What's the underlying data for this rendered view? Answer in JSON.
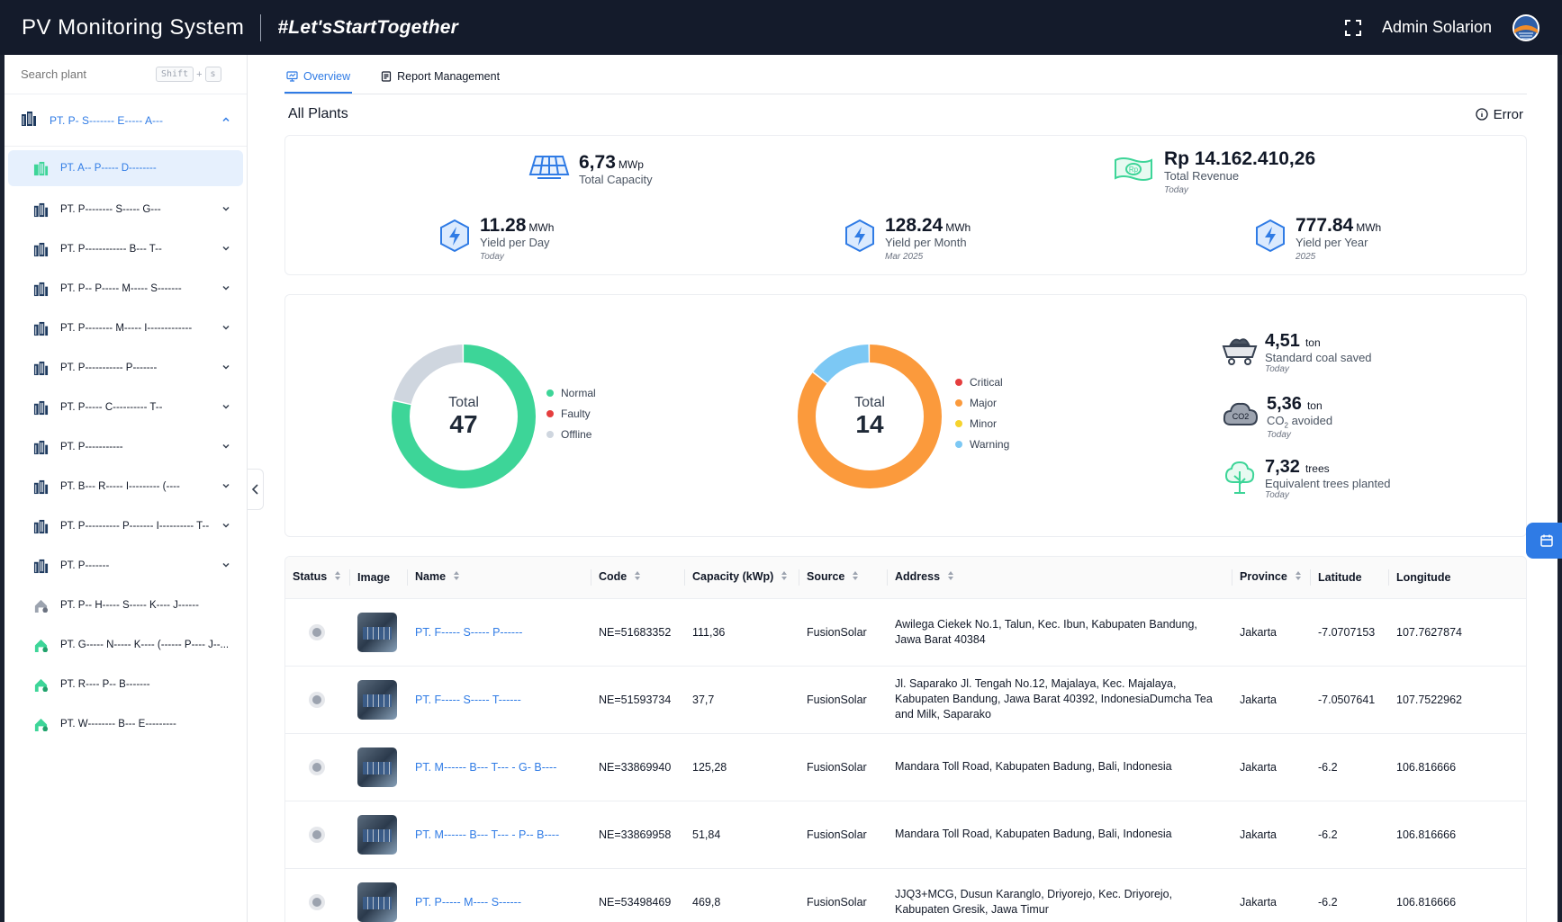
{
  "header": {
    "app_title": "PV Monitoring System",
    "tagline": "#Let'sStartTogether",
    "user_name": "Admin Solarion"
  },
  "sidebar": {
    "search_placeholder": "Search plant",
    "shortcut_key1": "Shift",
    "shortcut_plus": "+",
    "shortcut_key2": "s",
    "group_label": "PT. P- S------- E----- A---",
    "items": [
      {
        "label": "PT. A-- P----- D--------",
        "icon": "building-green-icon",
        "active": true
      },
      {
        "label": "PT. P-------- S----- G---",
        "icon": "building-icon"
      },
      {
        "label": "PT. P------------ B--- T--",
        "icon": "building-icon"
      },
      {
        "label": "PT. P-- P----- M----- S-------",
        "icon": "building-icon"
      },
      {
        "label": "PT. P-------- M----- I-------------",
        "icon": "building-icon"
      },
      {
        "label": "PT. P----------- P-------",
        "icon": "building-icon"
      },
      {
        "label": "PT. P----- C---------- T--",
        "icon": "building-icon"
      },
      {
        "label": "PT. P-----------",
        "icon": "building-icon"
      },
      {
        "label": "PT. B--- R----- I--------- (----",
        "icon": "building-icon"
      },
      {
        "label": "PT. P---------- P------- I---------- T--",
        "icon": "building-icon"
      },
      {
        "label": "PT. P-------",
        "icon": "building-icon"
      },
      {
        "label": "PT. P-- H----- S----- K---- J------",
        "icon": "house-gray-icon"
      },
      {
        "label": "PT. G----- N----- K---- (------ P---- J--...",
        "icon": "house-green-icon"
      },
      {
        "label": "PT. R---- P-- B-------",
        "icon": "house-green-icon"
      },
      {
        "label": "PT. W-------- B--- E---------",
        "icon": "house-green-icon"
      }
    ]
  },
  "tabs": [
    {
      "label": "Overview",
      "active": true
    },
    {
      "label": "Report Management",
      "active": false
    }
  ],
  "page": {
    "title": "All Plants",
    "error_label": "Error"
  },
  "kpis": {
    "capacity": {
      "value": "6,73",
      "unit": "MWp",
      "label": "Total Capacity"
    },
    "revenue": {
      "value": "Rp 14.162.410,26",
      "label": "Total Revenue",
      "sub": "Today"
    },
    "yield_day": {
      "value": "11.28",
      "unit": "MWh",
      "label": "Yield per Day",
      "sub": "Today"
    },
    "yield_month": {
      "value": "128.24",
      "unit": "MWh",
      "label": "Yield per Month",
      "sub": "Mar 2025"
    },
    "yield_year": {
      "value": "777.84",
      "unit": "MWh",
      "label": "Yield per Year",
      "sub": "2025"
    }
  },
  "status_donut": {
    "total_label": "Total",
    "total": "47",
    "segments": [
      {
        "name": "Normal",
        "value": 37,
        "color": "#3dd598"
      },
      {
        "name": "Faulty",
        "value": 0,
        "color": "#e53e3e"
      },
      {
        "name": "Offline",
        "value": 10,
        "color": "#cfd6df"
      }
    ]
  },
  "alarm_donut": {
    "total_label": "Total",
    "total": "14",
    "segments": [
      {
        "name": "Critical",
        "value": 0,
        "color": "#e53e3e"
      },
      {
        "name": "Major",
        "value": 12,
        "color": "#fb9a3c"
      },
      {
        "name": "Minor",
        "value": 0,
        "color": "#f6d32d"
      },
      {
        "name": "Warning",
        "value": 2,
        "color": "#7cc8f4"
      }
    ]
  },
  "environment": {
    "coal": {
      "value": "4,51",
      "unit": "ton",
      "label": "Standard coal saved",
      "sub": "Today"
    },
    "co2": {
      "value": "5,36",
      "unit": "ton",
      "label_prefix": "CO",
      "label_sub": "2",
      "label_suffix": " avoided",
      "sub": "Today",
      "icon_text": "CO2"
    },
    "trees": {
      "value": "7,32",
      "unit": "trees",
      "label": "Equivalent trees planted",
      "sub": "Today"
    }
  },
  "table": {
    "columns": [
      "Status",
      "Image",
      "Name",
      "Code",
      "Capacity (kWp)",
      "Source",
      "Address",
      "Province",
      "Latitude",
      "Longitude"
    ],
    "rows": [
      {
        "name": "PT. F----- S----- P------",
        "code": "NE=51683352",
        "capacity": "111,36",
        "source": "FusionSolar",
        "address": "Awilega Ciekek No.1, Talun, Kec. Ibun, Kabupaten Bandung, Jawa Barat 40384",
        "province": "Jakarta",
        "lat": "-7.0707153",
        "lng": "107.7627874"
      },
      {
        "name": "PT. F----- S----- T------",
        "code": "NE=51593734",
        "capacity": "37,7",
        "source": "FusionSolar",
        "address": "Jl. Saparako Jl. Tengah No.12, Majalaya, Kec. Majalaya, Kabupaten Bandung, Jawa Barat 40392, IndonesiaDumcha Tea and Milk, Saparako",
        "province": "Jakarta",
        "lat": "-7.0507641",
        "lng": "107.7522962"
      },
      {
        "name": "PT. M------ B--- T--- - G- B----",
        "code": "NE=33869940",
        "capacity": "125,28",
        "source": "FusionSolar",
        "address": "Mandara Toll Road, Kabupaten Badung, Bali, Indonesia",
        "province": "Jakarta",
        "lat": "-6.2",
        "lng": "106.816666"
      },
      {
        "name": "PT. M------ B--- T--- - P-- B----",
        "code": "NE=33869958",
        "capacity": "51,84",
        "source": "FusionSolar",
        "address": "Mandara Toll Road, Kabupaten Badung, Bali, Indonesia",
        "province": "Jakarta",
        "lat": "-6.2",
        "lng": "106.816666"
      },
      {
        "name": "PT. P----- M---- S------",
        "code": "NE=53498469",
        "capacity": "469,8",
        "source": "FusionSolar",
        "address": "JJQ3+MCG, Dusun Karanglo, Driyorejo, Kec. Driyorejo, Kabupaten Gresik, Jawa Timur",
        "province": "Jakarta",
        "lat": "-6.2",
        "lng": "106.816666"
      }
    ]
  },
  "colors": {
    "accent": "#2f7be5",
    "topbar": "#141b2b",
    "normal": "#3dd598",
    "major": "#fb9a3c"
  }
}
